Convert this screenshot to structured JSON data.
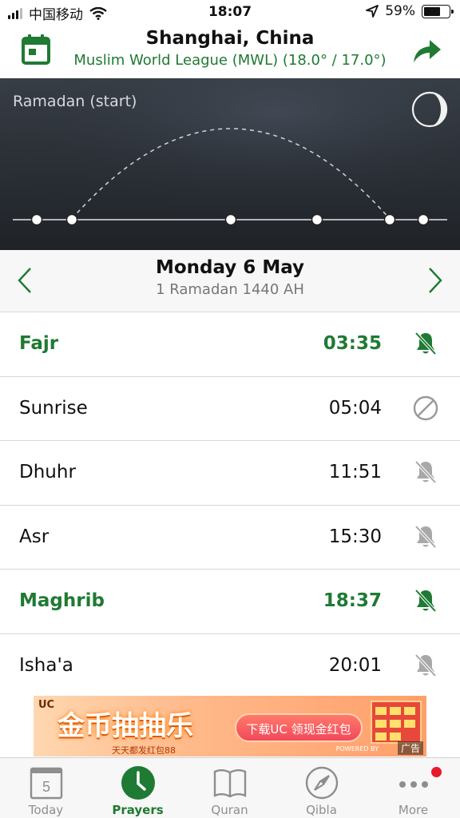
{
  "status_bar": {
    "carrier": "中国移动",
    "time": "18:07",
    "battery": "59%",
    "battery_level": 0.59
  },
  "header": {
    "location": "Shanghai, China",
    "method": "Muslim World League (MWL) (18.0° / 17.0°)",
    "calendar_icon": "calendar-icon",
    "share_icon": "share-icon",
    "accent_color": "#1f7a33"
  },
  "banner": {
    "label": "Ramadan (start)",
    "moon_icon": "moon-icon"
  },
  "date_nav": {
    "day": "Monday 6 May",
    "hijri": "1 Ramadan 1440 AH"
  },
  "prayers": [
    {
      "name": "Fajr",
      "time": "03:35",
      "alert": "bell-off-icon",
      "active": true
    },
    {
      "name": "Sunrise",
      "time": "05:04",
      "alert": "disabled-icon",
      "active": false
    },
    {
      "name": "Dhuhr",
      "time": "11:51",
      "alert": "bell-off-icon",
      "active": false
    },
    {
      "name": "Asr",
      "time": "15:30",
      "alert": "bell-off-icon",
      "active": false
    },
    {
      "name": "Maghrib",
      "time": "18:37",
      "alert": "bell-off-icon",
      "active": true
    },
    {
      "name": "Isha'a",
      "time": "20:01",
      "alert": "bell-off-icon",
      "active": false
    }
  ],
  "ad": {
    "brand": "UC",
    "slogan": "金币抽抽乐",
    "sub": "天天都发红包88",
    "cta": "下载UC 领现金红包",
    "powered": "POWERED BY",
    "tag": "广告"
  },
  "tabs": [
    {
      "label": "Today",
      "icon": "calendar-day-icon",
      "day": "5",
      "active": false
    },
    {
      "label": "Prayers",
      "icon": "clock-icon",
      "active": true
    },
    {
      "label": "Quran",
      "icon": "book-icon",
      "active": false
    },
    {
      "label": "Qibla",
      "icon": "compass-icon",
      "active": false
    },
    {
      "label": "More",
      "icon": "more-icon",
      "active": false,
      "badge": true
    }
  ]
}
